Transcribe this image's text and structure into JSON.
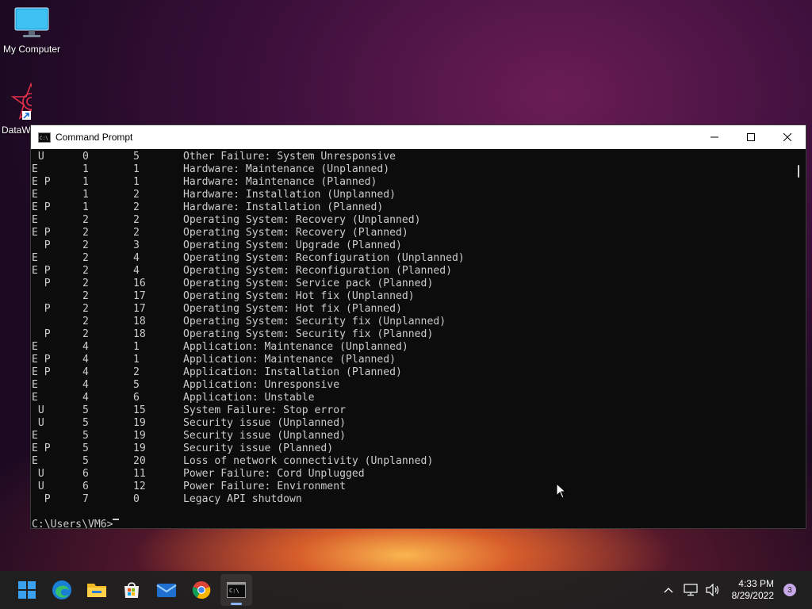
{
  "desktop": {
    "icons": [
      {
        "label": "My Computer"
      },
      {
        "label": "DataW"
      }
    ]
  },
  "window": {
    "title": "Command Prompt",
    "rows": [
      {
        "flags": " U",
        "major": "0",
        "minor": "5",
        "desc": "Other Failure: System Unresponsive"
      },
      {
        "flags": "E",
        "major": "1",
        "minor": "1",
        "desc": "Hardware: Maintenance (Unplanned)"
      },
      {
        "flags": "E P",
        "major": "1",
        "minor": "1",
        "desc": "Hardware: Maintenance (Planned)"
      },
      {
        "flags": "E",
        "major": "1",
        "minor": "2",
        "desc": "Hardware: Installation (Unplanned)"
      },
      {
        "flags": "E P",
        "major": "1",
        "minor": "2",
        "desc": "Hardware: Installation (Planned)"
      },
      {
        "flags": "E",
        "major": "2",
        "minor": "2",
        "desc": "Operating System: Recovery (Unplanned)"
      },
      {
        "flags": "E P",
        "major": "2",
        "minor": "2",
        "desc": "Operating System: Recovery (Planned)"
      },
      {
        "flags": "  P",
        "major": "2",
        "minor": "3",
        "desc": "Operating System: Upgrade (Planned)"
      },
      {
        "flags": "E",
        "major": "2",
        "minor": "4",
        "desc": "Operating System: Reconfiguration (Unplanned)"
      },
      {
        "flags": "E P",
        "major": "2",
        "minor": "4",
        "desc": "Operating System: Reconfiguration (Planned)"
      },
      {
        "flags": "  P",
        "major": "2",
        "minor": "16",
        "desc": "Operating System: Service pack (Planned)"
      },
      {
        "flags": "",
        "major": "2",
        "minor": "17",
        "desc": "Operating System: Hot fix (Unplanned)"
      },
      {
        "flags": "  P",
        "major": "2",
        "minor": "17",
        "desc": "Operating System: Hot fix (Planned)"
      },
      {
        "flags": "",
        "major": "2",
        "minor": "18",
        "desc": "Operating System: Security fix (Unplanned)"
      },
      {
        "flags": "  P",
        "major": "2",
        "minor": "18",
        "desc": "Operating System: Security fix (Planned)"
      },
      {
        "flags": "E",
        "major": "4",
        "minor": "1",
        "desc": "Application: Maintenance (Unplanned)"
      },
      {
        "flags": "E P",
        "major": "4",
        "minor": "1",
        "desc": "Application: Maintenance (Planned)"
      },
      {
        "flags": "E P",
        "major": "4",
        "minor": "2",
        "desc": "Application: Installation (Planned)"
      },
      {
        "flags": "E",
        "major": "4",
        "minor": "5",
        "desc": "Application: Unresponsive"
      },
      {
        "flags": "E",
        "major": "4",
        "minor": "6",
        "desc": "Application: Unstable"
      },
      {
        "flags": " U",
        "major": "5",
        "minor": "15",
        "desc": "System Failure: Stop error"
      },
      {
        "flags": " U",
        "major": "5",
        "minor": "19",
        "desc": "Security issue (Unplanned)"
      },
      {
        "flags": "E",
        "major": "5",
        "minor": "19",
        "desc": "Security issue (Unplanned)"
      },
      {
        "flags": "E P",
        "major": "5",
        "minor": "19",
        "desc": "Security issue (Planned)"
      },
      {
        "flags": "E",
        "major": "5",
        "minor": "20",
        "desc": "Loss of network connectivity (Unplanned)"
      },
      {
        "flags": " U",
        "major": "6",
        "minor": "11",
        "desc": "Power Failure: Cord Unplugged"
      },
      {
        "flags": " U",
        "major": "6",
        "minor": "12",
        "desc": "Power Failure: Environment"
      },
      {
        "flags": "  P",
        "major": "7",
        "minor": "0",
        "desc": "Legacy API shutdown"
      }
    ],
    "prompt": "C:\\Users\\VM6>"
  },
  "taskbar": {
    "apps": [
      {
        "name": "start-icon"
      },
      {
        "name": "edge-icon"
      },
      {
        "name": "file-explorer-icon"
      },
      {
        "name": "store-icon"
      },
      {
        "name": "mail-icon"
      },
      {
        "name": "chrome-icon"
      },
      {
        "name": "command-prompt-icon",
        "active": true
      }
    ],
    "time": "4:33 PM",
    "date": "8/29/2022",
    "notification_count": "3"
  }
}
